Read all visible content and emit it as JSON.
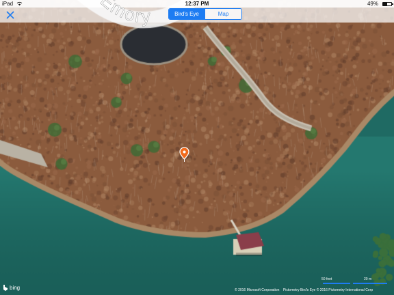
{
  "status_bar": {
    "device": "iPad",
    "time": "12:37 PM",
    "battery_percent": "49%",
    "battery_level": 0.49
  },
  "top_bar": {
    "close_icon": "close-icon",
    "segments": [
      "Bird's Eye",
      "Map"
    ],
    "active_segment": "Bird's Eye"
  },
  "map": {
    "road_label": "Emory",
    "pin_color": "#f26a1b",
    "water_color": "#1f6a63",
    "land_color": "#8b5b3d"
  },
  "footer": {
    "logo": "bing",
    "copyright_microsoft": "© 2016 Microsoft Corporation",
    "copyright_pictometry": "Pictometry Bird's Eye © 2016 Pictometry International Corp",
    "scale_feet": "50 feet",
    "scale_meters": "20 m"
  }
}
